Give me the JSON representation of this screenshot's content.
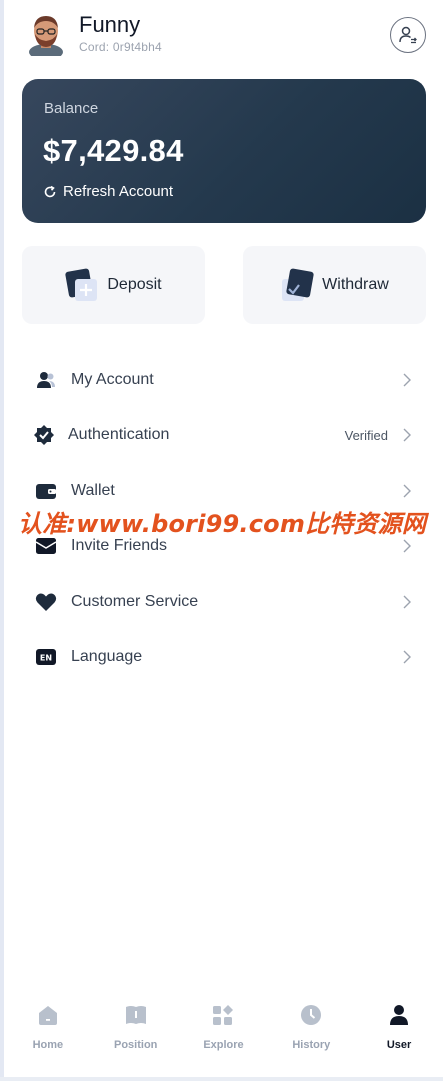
{
  "header": {
    "user_name": "Funny",
    "cord_label": "Cord:",
    "cord_value": "0r9t4bh4"
  },
  "balance": {
    "label": "Balance",
    "amount": "$7,429.84",
    "refresh_label": "Refresh Account"
  },
  "actions": {
    "deposit_label": "Deposit",
    "withdraw_label": "Withdraw"
  },
  "menu": {
    "items": [
      {
        "label": "My Account",
        "icon": "user-group-icon",
        "value": ""
      },
      {
        "label": "Authentication",
        "icon": "verified-badge-icon",
        "value": "Verified"
      },
      {
        "label": "Wallet",
        "icon": "wallet-icon",
        "value": ""
      },
      {
        "label": "Invite Friends",
        "icon": "envelope-icon",
        "value": ""
      },
      {
        "label": "Customer Service",
        "icon": "heart-icon",
        "value": ""
      },
      {
        "label": "Language",
        "icon": "en-language-icon",
        "value": ""
      }
    ]
  },
  "watermark": "认准:www.bori99.com比特资源网",
  "nav": {
    "items": [
      {
        "label": "Home",
        "icon": "home-icon",
        "active": false
      },
      {
        "label": "Position",
        "icon": "book-icon",
        "active": false
      },
      {
        "label": "Explore",
        "icon": "grid-icon",
        "active": false
      },
      {
        "label": "History",
        "icon": "clock-icon",
        "active": false
      },
      {
        "label": "User",
        "icon": "user-icon",
        "active": true
      }
    ]
  },
  "colors": {
    "card_dark": "#24394d",
    "icon_dark": "#1e2b3c",
    "nav_inactive": "#9aa3b2",
    "watermark": "#e3521e"
  }
}
